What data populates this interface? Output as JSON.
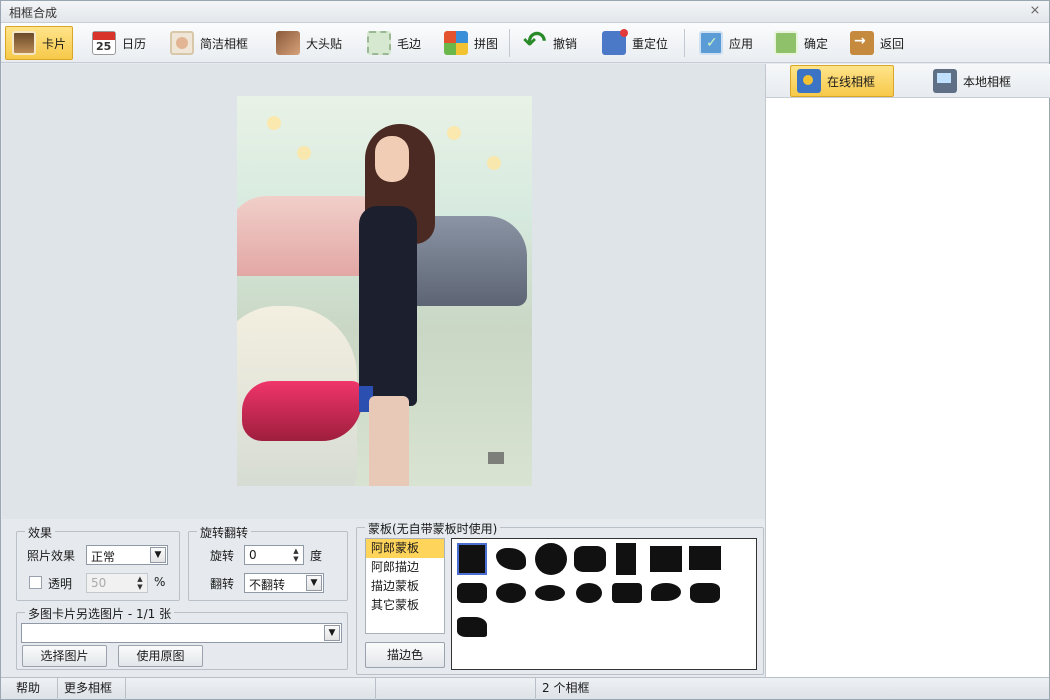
{
  "window": {
    "title": "相框合成",
    "close_glyph": "⨯"
  },
  "toolbar": {
    "card": "卡片",
    "calendar": "日历",
    "simple_frame": "简洁相框",
    "big_head": "大头贴",
    "edge": "毛边",
    "puzzle": "拼图",
    "undo": "撤销",
    "reposition": "重定位",
    "apply": "应用",
    "confirm": "确定",
    "back": "返回"
  },
  "right_tabs": {
    "online": "在线相框",
    "local": "本地相框"
  },
  "effects": {
    "legend": "效果",
    "photo_effect_label": "照片效果",
    "photo_effect_value": "正常",
    "transparent_label": "透明",
    "transparent_value": "50",
    "percent": "%"
  },
  "rotate": {
    "legend": "旋转翻转",
    "rotate_label": "旋转",
    "rotate_value": "0",
    "degree": "度",
    "flip_label": "翻转",
    "flip_value": "不翻转"
  },
  "multi": {
    "legend": "多图卡片另选图片 - 1/1 张",
    "select_image": "选择图片",
    "use_original": "使用原图"
  },
  "mask": {
    "legend": "蒙板(无自带蒙板时使用)",
    "list": [
      "阿郎蒙板",
      "阿郎描边",
      "描边蒙板",
      "其它蒙板"
    ],
    "selected_index": 0,
    "stroke_color": "描边色"
  },
  "status": {
    "help": "帮助",
    "more_frames": "更多相框",
    "frame_count": "2 个相框"
  },
  "colors": {
    "active_tab": "#f7c94a",
    "selected_item": "#ffd45a"
  }
}
